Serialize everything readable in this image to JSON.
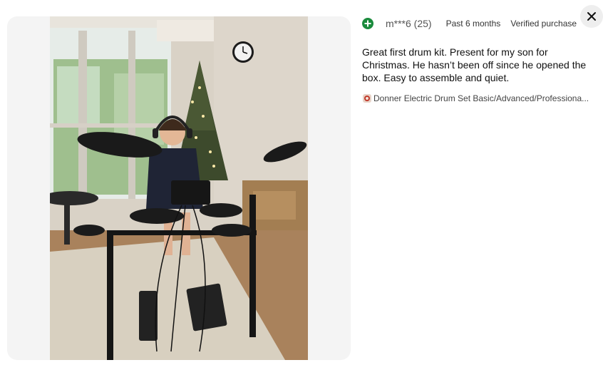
{
  "review": {
    "reviewer": "m***6 (25)",
    "time": "Past 6 months",
    "verified": "Verified purchase",
    "body": "Great first drum kit. Present for my son for Christmas. He hasn’t been off since he opened the box. Easy to assemble and quiet.",
    "product_name": "Donner Electric Drum Set Basic/Advanced/Professiona..."
  },
  "icons": {
    "avatar": "plus-icon",
    "product": "product-thumbnail-icon",
    "close": "close-icon"
  },
  "colors": {
    "avatar_bg": "#1a8b3c",
    "panel_bg": "#f4f4f4",
    "close_bg": "#eeeeee"
  }
}
